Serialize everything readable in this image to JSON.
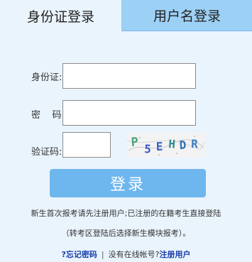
{
  "tabs": {
    "id_login": "身份证登录",
    "username_login": "用户名登录"
  },
  "form": {
    "id_label": "身份证:",
    "password_label": "密    码:",
    "captcha_label": "验证码:",
    "id_value": "",
    "password_value": "",
    "captcha_value": ""
  },
  "captcha": {
    "text": "P5EHDR"
  },
  "login_button": "登录",
  "notices": {
    "line1": "新生首次报考请先注册用户;已注册的在籍考生直接登陆",
    "line2": "（转考区登陆后选择新生模块报考）。"
  },
  "footer": {
    "forgot_password": "?忘记密码",
    "separator": "|",
    "no_account": "没有在线帐号?",
    "register": "注册用户"
  }
}
